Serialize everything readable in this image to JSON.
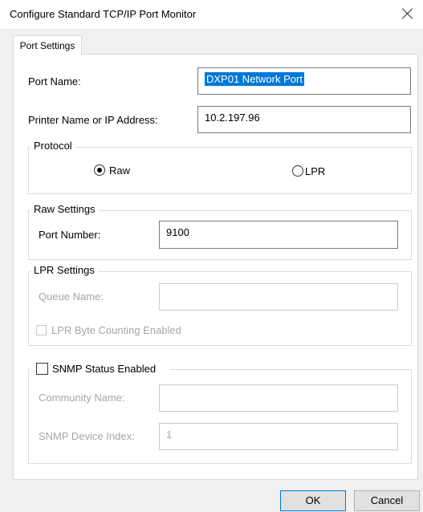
{
  "window": {
    "title": "Configure Standard TCP/IP Port Monitor"
  },
  "tabs": [
    {
      "label": "Port Settings"
    }
  ],
  "port_name": {
    "label": "Port Name:",
    "value": "DXP01 Network Port"
  },
  "printer_address": {
    "label": "Printer Name or IP Address:",
    "value": "10.2.197.96"
  },
  "protocol": {
    "legend": "Protocol",
    "options": [
      {
        "label": "Raw",
        "selected": true
      },
      {
        "label": "LPR",
        "selected": false
      }
    ]
  },
  "raw_settings": {
    "legend": "Raw Settings",
    "port_number_label": "Port Number:",
    "port_number_value": "9100"
  },
  "lpr_settings": {
    "legend": "LPR Settings",
    "queue_name_label": "Queue Name:",
    "queue_name_value": "",
    "byte_counting_label": "LPR Byte Counting Enabled",
    "byte_counting_checked": false
  },
  "snmp": {
    "label": "SNMP Status Enabled",
    "checked": false,
    "community_name_label": "Community Name:",
    "community_name_value": "",
    "device_index_label": "SNMP Device Index:",
    "device_index_value": "1"
  },
  "buttons": {
    "ok": "OK",
    "cancel": "Cancel"
  },
  "colors": {
    "selection": "#0078d7",
    "disabled_text": "#a6a6a6",
    "dialog_bg": "#f0f0f0"
  }
}
